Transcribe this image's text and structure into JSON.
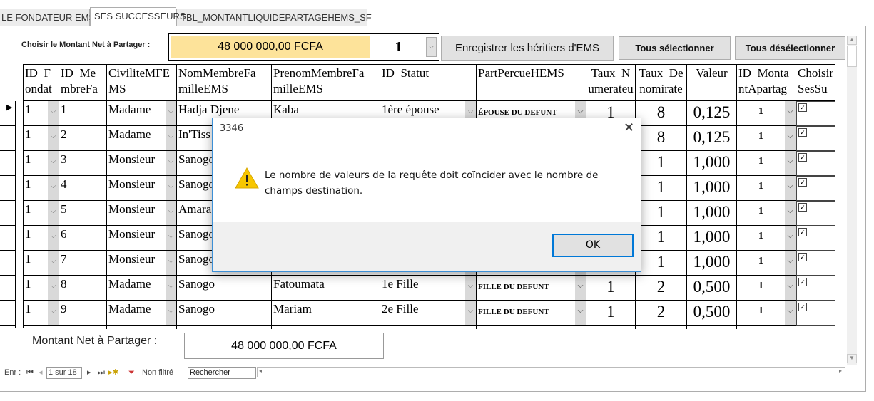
{
  "tabs": [
    {
      "label": "LE FONDATEUR EMS"
    },
    {
      "label": "SES SUCCESSEURS",
      "active": true
    },
    {
      "label": "TBL_MONTANTLIQUIDEPARTAGEHEMS_SF"
    }
  ],
  "toolbar": {
    "choose_label": "Choisir le Montant Net à Partager :",
    "amount_value": "48 000 000,00 FCFA",
    "amount_id": "1",
    "save_heirs": "Enregistrer les héritiers d'EMS",
    "select_all": "Tous sélectionner",
    "deselect_all": "Tous désélectionner"
  },
  "colors": {
    "amount_bg": "#fde39a",
    "dialog_border": "#3c8fd6",
    "ok_border": "#0078d7",
    "warning": "#f7c600"
  },
  "table": {
    "headers": [
      "ID_F ondat",
      "ID_Me mbreFa",
      "CiviliteMFE MS",
      "NomMembreFa milleEMS",
      "PrenomMembreFa milleEMS",
      "ID_Statut",
      "PartPercueHEMS",
      "Taux_N umerateu",
      "Taux_De nomirate",
      "Valeur",
      "ID_Monta ntApartag",
      "Choisir SesSu"
    ],
    "rows": [
      [
        "1",
        "1",
        "Madame",
        "Hadja  Djene",
        "Kaba",
        "1ère épouse",
        "ÉPOUSE DU DEFUNT",
        "1",
        "8",
        "0,125",
        "1",
        true
      ],
      [
        "1",
        "2",
        "Madame",
        "In'Tiss",
        "",
        "",
        "",
        "",
        "8",
        "0,125",
        "1",
        true
      ],
      [
        "1",
        "3",
        "Monsieur",
        "Sanogo",
        "",
        "",
        "",
        "",
        "1",
        "1,000",
        "1",
        true
      ],
      [
        "1",
        "4",
        "Monsieur",
        "Sanogo",
        "",
        "",
        "",
        "",
        "1",
        "1,000",
        "1",
        true
      ],
      [
        "1",
        "5",
        "Monsieur",
        "Amara (Oum",
        "",
        "",
        "",
        "",
        "1",
        "1,000",
        "1",
        true
      ],
      [
        "1",
        "6",
        "Monsieur",
        "Sanogo",
        "",
        "",
        "",
        "",
        "1",
        "1,000",
        "1",
        true
      ],
      [
        "1",
        "7",
        "Monsieur",
        "Sanogo",
        "",
        "",
        "",
        "",
        "1",
        "1,000",
        "1",
        true
      ],
      [
        "1",
        "8",
        "Madame",
        "Sanogo",
        "Fatoumata",
        "1e Fille",
        "FILLE DU DEFUNT",
        "1",
        "2",
        "0,500",
        "1",
        true
      ],
      [
        "1",
        "9",
        "Madame",
        "Sanogo",
        "Mariam",
        "2e Fille",
        "FILLE DU DEFUNT",
        "1",
        "2",
        "0,500",
        "1",
        true
      ]
    ]
  },
  "footer": {
    "label": "Montant Net à Partager :",
    "value": "48 000 000,00 FCFA"
  },
  "navigation": {
    "prefix": "Enr :",
    "record": "1 sur 18",
    "filter": "Non filtré",
    "search": "Rechercher"
  },
  "dialog": {
    "title": "3346",
    "message": "Le nombre de valeurs de la requête doit coïncider avec le nombre de champs destination.",
    "ok": "OK",
    "icon": "warning-icon"
  }
}
